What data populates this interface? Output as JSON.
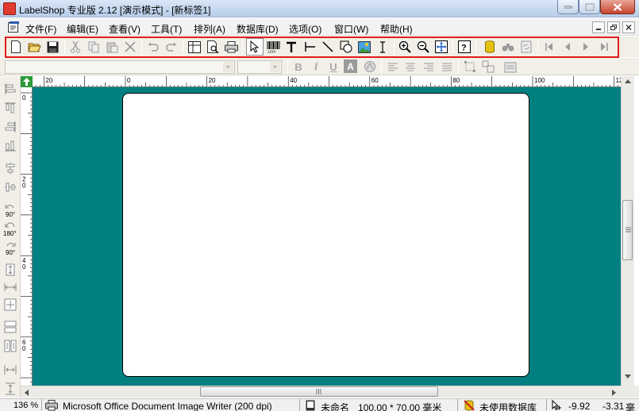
{
  "window": {
    "title": "LabelShop 专业版 2.12 [演示模式] - [新标签1]"
  },
  "menu": {
    "items": [
      "文件(F)",
      "编辑(E)",
      "查看(V)",
      "工具(T)",
      "排列(A)",
      "数据库(D)",
      "选项(O)",
      "窗口(W)",
      "帮助(H)"
    ]
  },
  "toolbar_main": {
    "icons": [
      "new-icon",
      "open-icon",
      "save-icon",
      "cut-icon",
      "copy-icon",
      "paste-icon",
      "delete-icon",
      "undo-icon",
      "redo-icon",
      "page-setup-icon",
      "print-preview-icon",
      "print-icon",
      "select-pointer-icon",
      "barcode-icon",
      "text-icon",
      "line-icon",
      "diagonal-line-icon",
      "shape-icon",
      "image-icon",
      "text-cursor-icon",
      "zoom-in-icon",
      "zoom-out-icon",
      "zoom-fit-icon",
      "help-icon",
      "database-icon",
      "search-records-icon",
      "refresh-icon",
      "first-record-icon",
      "prev-record-icon",
      "next-record-icon",
      "last-record-icon"
    ],
    "highlight_color": "#e21a1a"
  },
  "toolbar_format": {
    "bold": "B",
    "italic": "I",
    "underline": "U",
    "text_color": "A"
  },
  "ruler": {
    "horizontal_labels": [
      "20",
      "0",
      "20",
      "40",
      "60",
      "80",
      "100",
      "12"
    ],
    "vertical_labels": [
      "0",
      "2",
      "4",
      "6"
    ],
    "vertical_sub_labels": [
      "",
      "0",
      "0",
      "0"
    ]
  },
  "left_tools": {
    "icons": [
      "align-left-icon",
      "align-top-icon",
      "align-right-icon",
      "align-bottom-icon",
      "center-horizontal-icon",
      "center-vertical-icon",
      "rotate-90-ccw-icon",
      "rotate-180-icon",
      "rotate-90-cw-icon",
      "same-height-icon",
      "same-width-icon",
      "same-size-icon",
      "space-horizontal-icon",
      "space-vertical-icon",
      "distribute-horizontal-icon",
      "distribute-vertical-icon"
    ],
    "rotate_labels": [
      "90°",
      "180°",
      "90°"
    ]
  },
  "canvas": {
    "background_color": "#008080",
    "page_color": "#ffffff"
  },
  "status": {
    "zoom": "136 %",
    "printer": "Microsoft Office Document Image Writer (200 dpi)",
    "document": "未命名",
    "label_size": "100.00 * 70.00 毫米",
    "database_status": "未使用数据库",
    "coord_x": "-9.92",
    "coord_y": "-3.31",
    "coord_unit": "毫"
  }
}
